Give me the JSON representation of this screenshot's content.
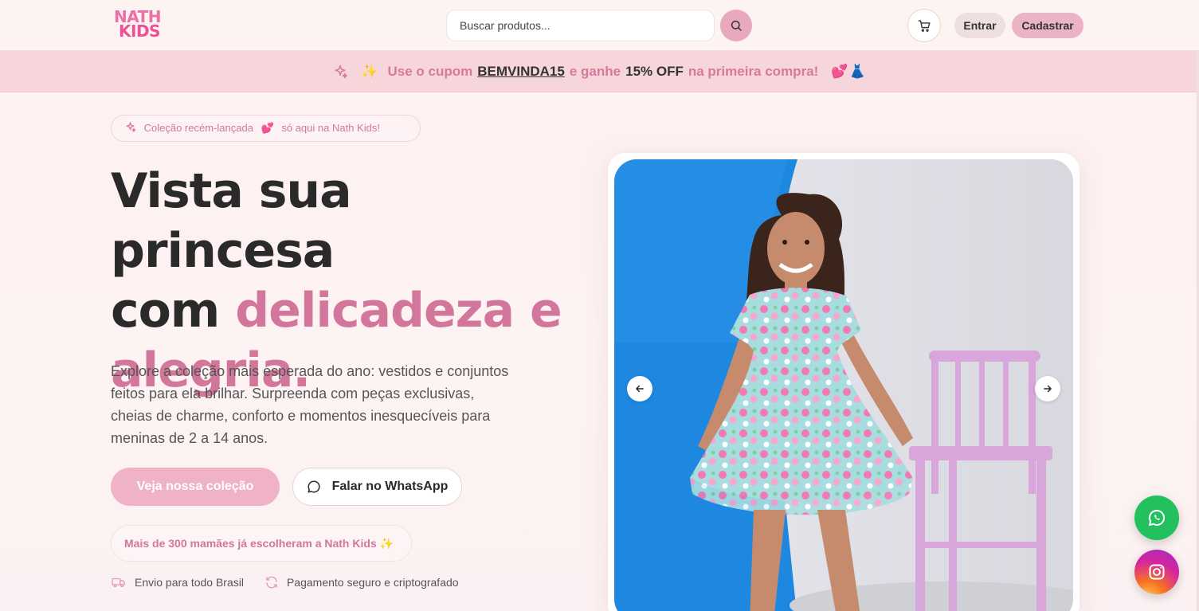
{
  "header": {
    "logo_line1": "NATH",
    "logo_line2": "KIDS",
    "search_placeholder": "Buscar produtos...",
    "search_icon": "search-icon",
    "cart_icon": "cart-icon",
    "login_label": "Entrar",
    "signup_label": "Cadastrar"
  },
  "promo": {
    "part1": "Use o cupom",
    "code": "BEMVINDA15",
    "part2": "e ganhe",
    "discount": "15% OFF",
    "part3": "na primeira compra!",
    "emoji": "💕👗",
    "sparkle": "✨"
  },
  "hero": {
    "badge_text": "Coleção recém-lançada",
    "badge_emoji": "💕",
    "badge_text2": "só aqui na Nath Kids!",
    "headline_line1": "Vista sua princesa",
    "headline_word_com": "com",
    "headline_pink1": "delicadeza e",
    "headline_pink2": "alegria.",
    "description": "Explore a coleção mais esperada do ano: vestidos e conjuntos feitos para ela brilhar. Surpreenda com peças exclusivas, cheias de charme, conforto e momentos inesquecíveis para meninas de 2 a 14 anos.",
    "primary_button": "Veja nossa coleção",
    "whatsapp_button": "Falar no WhatsApp",
    "social_proof": "Mais de 300 mamães já escolheram a Nath Kids",
    "social_proof_emoji": "✨",
    "feature_shipping": "Envio para todo Brasil",
    "feature_payment": "Pagamento seguro e criptografado"
  },
  "colors": {
    "brand_pink": "#d2779b",
    "button_pink": "#efb2c7",
    "whatsapp_green": "#22c15e"
  }
}
